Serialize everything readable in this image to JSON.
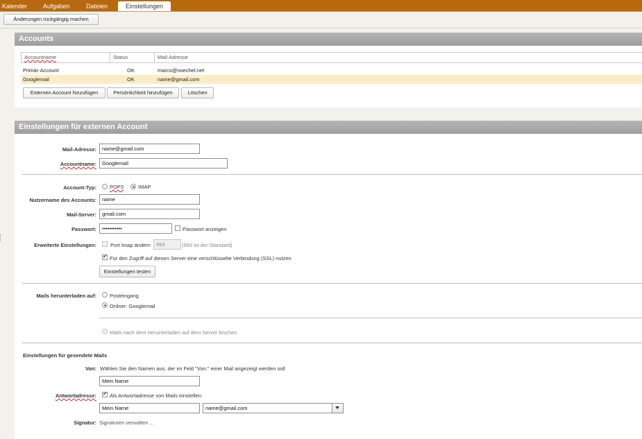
{
  "tabs": [
    {
      "label": "Kalender"
    },
    {
      "label": "Aufgaben"
    },
    {
      "label": "Dateien"
    },
    {
      "label": "Einstellungen"
    }
  ],
  "toolbar": {
    "undo_label": "Änderungen rückgängig machen"
  },
  "accounts": {
    "title": "Accounts",
    "columns": [
      "Accountname",
      "Status",
      "Mail-Adresse"
    ],
    "rows": [
      {
        "name": "Primär-Account",
        "status": "OK",
        "email": "marco@noechel.net"
      },
      {
        "name": "Googlemail",
        "status": "OK",
        "email": "name@gmail.com"
      }
    ],
    "buttons": {
      "add_external": "Externen Account hinzufügen",
      "add_identity": "Persönlichkeit hinzufügen",
      "delete": "Löschen"
    }
  },
  "external": {
    "title": "Einstellungen für externen Account",
    "mail_address": {
      "label": "Mail-Adresse:",
      "value": "name@gmail.com"
    },
    "account_name": {
      "label": "Accountname:",
      "value": "Googlemail"
    },
    "account_type": {
      "label": "Account-Typ:",
      "options": [
        "POP3",
        "IMAP"
      ],
      "selected": "IMAP"
    },
    "username": {
      "label": "Nutzername des Accounts:",
      "value": "name"
    },
    "server": {
      "label": "Mail-Server:",
      "value": "gmail.com"
    },
    "password": {
      "label": "Passwort:",
      "value": "•••••••••••",
      "show_label": "Passwort anzeigen"
    },
    "advanced": {
      "label": "Erweiterte Einstellungen:",
      "port_label": "Port Imap ändern",
      "port_value": "993",
      "port_hint": "(993 ist der Standard)",
      "ssl_label": "Für den Zugriff auf diesen Server eine verschlüsselte Verbindung (SSL) nutzen",
      "test_button": "Einstellungen testen"
    },
    "download": {
      "label": "Mails herunterladen auf:",
      "inbox": "Posteingang",
      "folder": "Ordner: Googlemail",
      "delete_on_server": "Mails nach dem Herunterladen auf dem Server löschen"
    },
    "sent": {
      "title": "Einstellungen für gesendete Mails",
      "from_label": "Von:",
      "from_hint": "Wählen Sie den Namen aus, der im Feld \"Von:\" einer Mail angezeigt werden soll",
      "from_name": "Mein Name",
      "reply_label": "Antwortadresse:",
      "reply_check": "Als Antwortadresse von Mails einstellen:",
      "reply_name": "Mein Name",
      "reply_email": "name@gmail.com",
      "signature_label": "Signatur:",
      "signature_link": "Signaturen verwalten ..."
    }
  }
}
